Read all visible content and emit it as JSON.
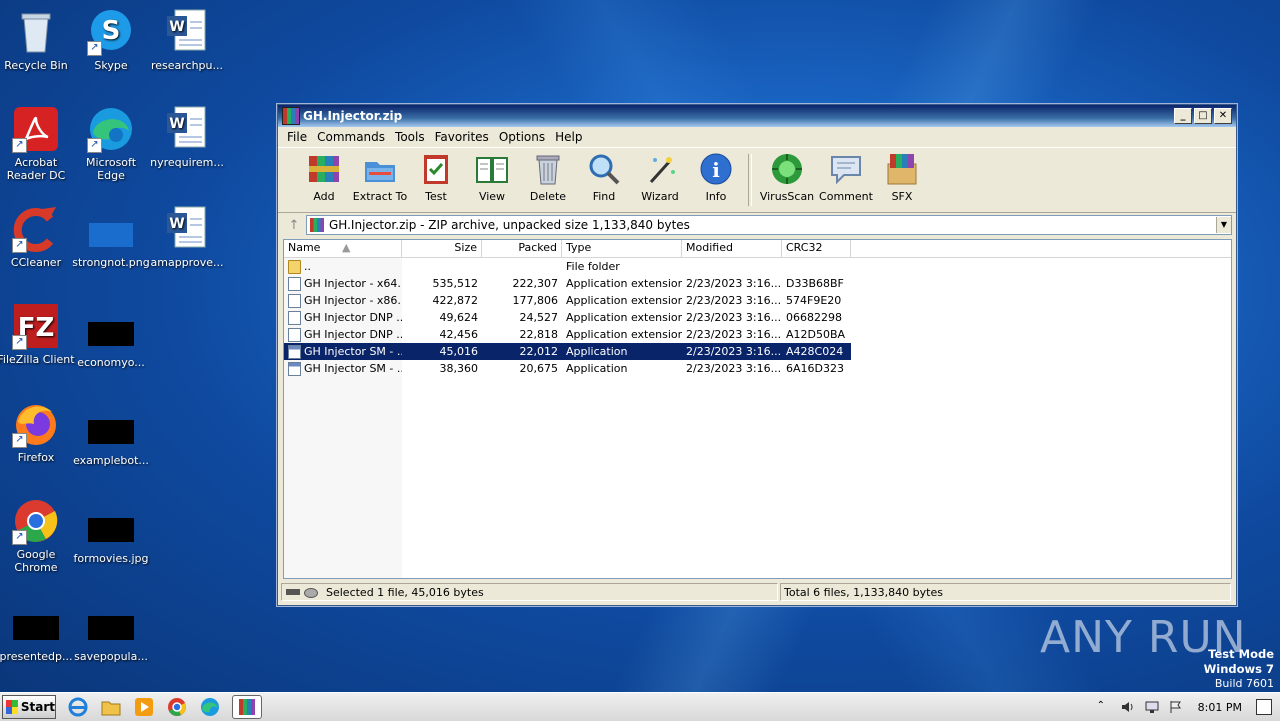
{
  "desktop": {
    "icons": [
      {
        "label": "Recycle Bin"
      },
      {
        "label": "Skype"
      },
      {
        "label": "researchpu..."
      },
      {
        "label": "Acrobat Reader DC"
      },
      {
        "label": "Microsoft Edge"
      },
      {
        "label": "nyrequirem..."
      },
      {
        "label": "CCleaner"
      },
      {
        "label": "strongnot.png"
      },
      {
        "label": "amapprove..."
      },
      {
        "label": "FileZilla Client"
      },
      {
        "label": "economyo..."
      },
      {
        "label": "Firefox"
      },
      {
        "label": "examplebot..."
      },
      {
        "label": "Google Chrome"
      },
      {
        "label": "formovies.jpg"
      },
      {
        "label": "presentedp..."
      },
      {
        "label": "savepopula..."
      }
    ]
  },
  "window": {
    "title": "GH.Injector.zip",
    "menu": [
      "File",
      "Commands",
      "Tools",
      "Favorites",
      "Options",
      "Help"
    ],
    "toolbar": [
      "Add",
      "Extract To",
      "Test",
      "View",
      "Delete",
      "Find",
      "Wizard",
      "Info",
      "VirusScan",
      "Comment",
      "SFX"
    ],
    "address": "GH.Injector.zip - ZIP archive, unpacked size 1,133,840 bytes",
    "columns": [
      "Name",
      "Size",
      "Packed",
      "Type",
      "Modified",
      "CRC32"
    ],
    "rows": [
      {
        "name": "..",
        "size": "",
        "packed": "",
        "type": "File folder",
        "modified": "",
        "crc": "",
        "icon": "folder"
      },
      {
        "name": "GH Injector - x64...",
        "size": "535,512",
        "packed": "222,307",
        "type": "Application extension",
        "modified": "2/23/2023 3:16...",
        "crc": "D33B68BF",
        "icon": "dll"
      },
      {
        "name": "GH Injector - x86...",
        "size": "422,872",
        "packed": "177,806",
        "type": "Application extension",
        "modified": "2/23/2023 3:16...",
        "crc": "574F9E20",
        "icon": "dll"
      },
      {
        "name": "GH Injector DNP ...",
        "size": "49,624",
        "packed": "24,527",
        "type": "Application extension",
        "modified": "2/23/2023 3:16...",
        "crc": "06682298",
        "icon": "dll"
      },
      {
        "name": "GH Injector DNP ...",
        "size": "42,456",
        "packed": "22,818",
        "type": "Application extension",
        "modified": "2/23/2023 3:16...",
        "crc": "A12D50BA",
        "icon": "dll"
      },
      {
        "name": "GH Injector SM - ...",
        "size": "45,016",
        "packed": "22,012",
        "type": "Application",
        "modified": "2/23/2023 3:16...",
        "crc": "A428C024",
        "icon": "app",
        "selected": true
      },
      {
        "name": "GH Injector SM - ...",
        "size": "38,360",
        "packed": "20,675",
        "type": "Application",
        "modified": "2/23/2023 3:16...",
        "crc": "6A16D323",
        "icon": "app"
      }
    ],
    "status_left": "Selected 1 file, 45,016 bytes",
    "status_right": "Total 6 files, 1,133,840 bytes"
  },
  "watermark": "ANY RUN",
  "testmode": {
    "line1": "Test Mode",
    "line2": "Windows 7",
    "line3": "Build 7601"
  },
  "taskbar": {
    "start": "Start",
    "clock": "8:01 PM"
  }
}
